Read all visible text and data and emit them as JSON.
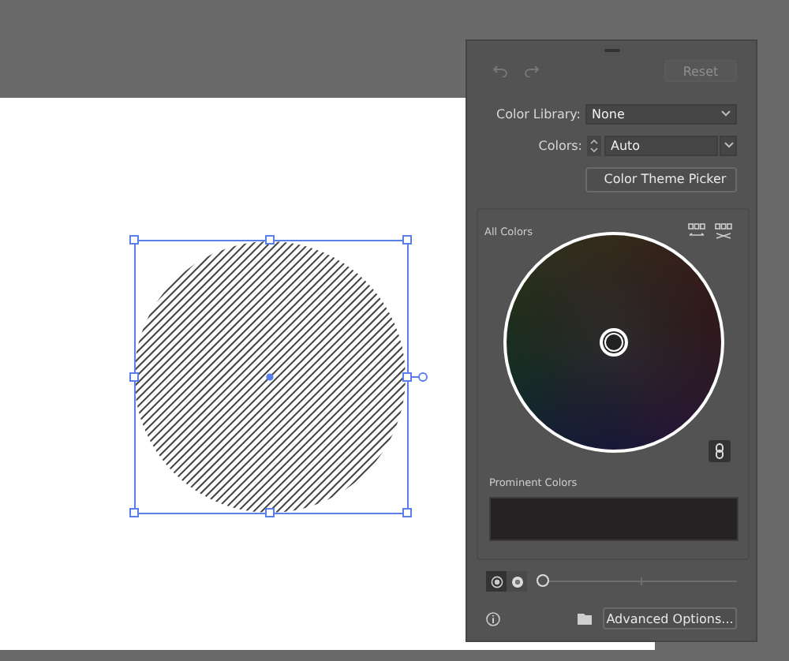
{
  "history": {
    "undo_disabled": true,
    "redo_disabled": true,
    "reset": "Reset",
    "reset_disabled": true
  },
  "color_library": {
    "label": "Color Library:",
    "value": "None"
  },
  "colors": {
    "label": "Colors:",
    "value": "Auto"
  },
  "theme_picker": "Color Theme Picker",
  "wheel": {
    "label": "All Colors"
  },
  "prominent": {
    "label": "Prominent Colors"
  },
  "view_modes": [
    {
      "kind": "smooth",
      "selected": true
    },
    {
      "kind": "segmented",
      "selected": false
    }
  ],
  "slider": {
    "level": 0
  },
  "advanced": "Advanced Options..."
}
